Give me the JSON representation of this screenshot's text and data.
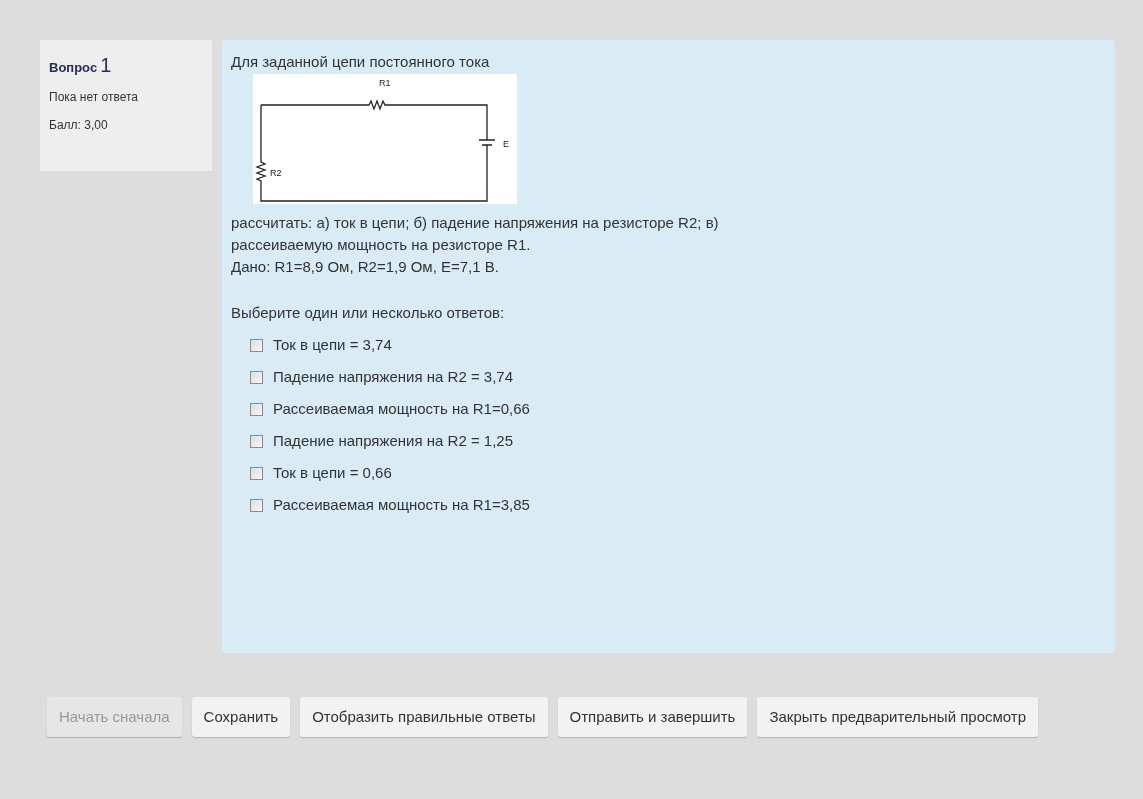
{
  "question_info": {
    "label": "Вопрос",
    "number": "1",
    "state": "Пока нет ответа",
    "grade": "Балл: 3,00"
  },
  "question": {
    "intro": "Для заданной цепи постоянного тока",
    "circuit": {
      "labels": [
        "R1",
        "R2",
        "E"
      ]
    },
    "text_lines": [
      "рассчитать: а) ток в цепи; б) падение напряжения на резисторе R2; в)",
      "рассеиваемую мощность на резисторе R1.",
      "Дано: R1=8,9 Ом, R2=1,9 Ом, E=7,1 В."
    ],
    "prompt": "Выберите один или несколько ответов:",
    "options": [
      {
        "label": "Ток в цепи = 3,74",
        "checked": false
      },
      {
        "label": "Падение напряжения на R2 = 3,74",
        "checked": false
      },
      {
        "label": "Рассеиваемая мощность на R1=0,66",
        "checked": false
      },
      {
        "label": "Падение напряжения на R2 = 1,25",
        "checked": false
      },
      {
        "label": "Ток в цепи = 0,66",
        "checked": false
      },
      {
        "label": "Рассеиваемая мощность на R1=3,85",
        "checked": false
      }
    ]
  },
  "buttons": [
    {
      "label": "Начать сначала",
      "disabled": true
    },
    {
      "label": "Сохранить",
      "disabled": false
    },
    {
      "label": "Отобразить правильные ответы",
      "disabled": false
    },
    {
      "label": "Отправить и завершить",
      "disabled": false
    },
    {
      "label": "Закрыть предварительный просмотр",
      "disabled": false
    }
  ]
}
